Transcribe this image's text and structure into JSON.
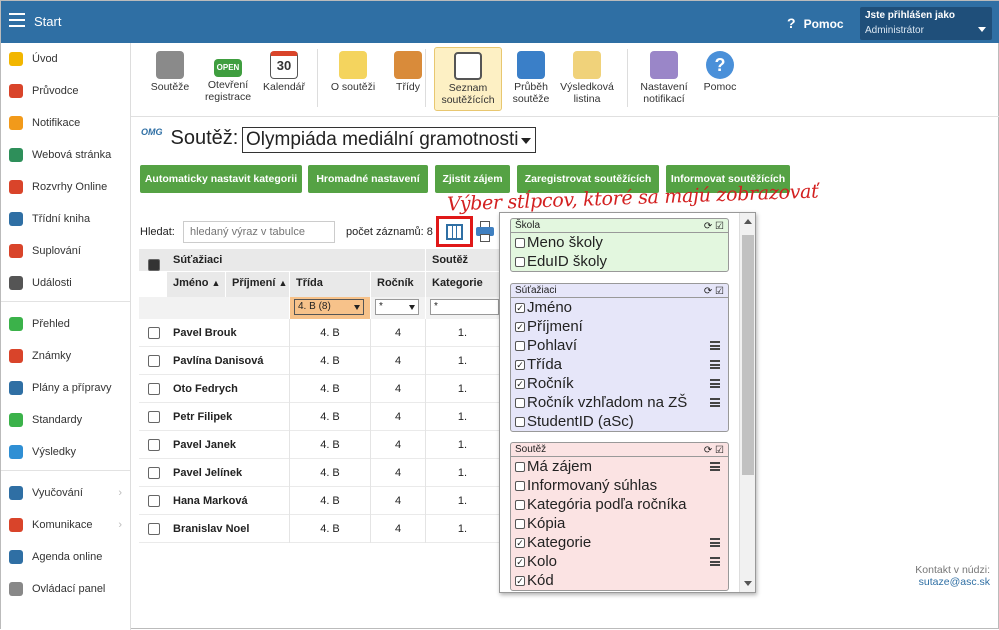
{
  "topbar": {
    "title": "Start",
    "help": "Pomoc",
    "user_line1": "Jste přihlášen jako",
    "user_line2": "Administrátor"
  },
  "sidebar": {
    "items": [
      {
        "label": "Úvod",
        "color": "#f2b600"
      },
      {
        "label": "Průvodce",
        "color": "#d9442a"
      },
      {
        "label": "Notifikace",
        "color": "#f29a1a"
      },
      {
        "label": "Webová stránka",
        "color": "#2e8f5a"
      },
      {
        "label": "Rozvrhy Online",
        "color": "#d9442a"
      },
      {
        "label": "Třídní kniha",
        "color": "#2f6fa4"
      },
      {
        "label": "Suplování",
        "color": "#d9442a"
      },
      {
        "label": "Události",
        "color": "#555555"
      },
      {
        "label": "Přehled",
        "color": "#3bb24a"
      },
      {
        "label": "Známky",
        "color": "#d9442a"
      },
      {
        "label": "Plány a přípravy",
        "color": "#2f6fa4"
      },
      {
        "label": "Standardy",
        "color": "#3bb24a"
      },
      {
        "label": "Výsledky",
        "color": "#2f8fd4"
      },
      {
        "label": "Vyučování",
        "color": "#2f6fa4"
      },
      {
        "label": "Komunikace",
        "color": "#d9442a"
      },
      {
        "label": "Agenda online",
        "color": "#2f6fa4"
      },
      {
        "label": "Ovládací panel",
        "color": "#888888"
      }
    ]
  },
  "toolbar": {
    "items": [
      {
        "label": "Soutěže",
        "icon": "scales-icon"
      },
      {
        "label": "Otevření registrace",
        "icon": "open-sign-icon"
      },
      {
        "label": "Kalendář",
        "icon": "calendar-icon",
        "day": "30",
        "open": "OPEN"
      },
      {
        "label": "O soutěži",
        "icon": "lightbulb-icon"
      },
      {
        "label": "Třídy",
        "icon": "student-icon"
      },
      {
        "label": "Seznam soutěžících",
        "icon": "badge-icon"
      },
      {
        "label": "Průběh soutěže",
        "icon": "stopwatch-icon"
      },
      {
        "label": "Výsledková listina",
        "icon": "certificate-icon"
      },
      {
        "label": "Nastavení notifikací",
        "icon": "gear-icon"
      },
      {
        "label": "Pomoc",
        "icon": "help-icon"
      }
    ]
  },
  "competition": {
    "logo": "OMG",
    "label": "Soutěž:",
    "selected": "Olympiáda mediální gramotnosti"
  },
  "buttons": [
    "Automaticky nastavit kategorii",
    "Hromadné nastavení",
    "Zjistit zájem",
    "Zaregistrovat soutěžících",
    "Informovat soutěžících"
  ],
  "annotation": "Výber stĺpcov, ktoré sa majú zobrazovať",
  "search": {
    "label": "Hledat:",
    "placeholder": "hledaný výraz v tabulce",
    "count_label": "počet záznamů: 8"
  },
  "table": {
    "group1": "Súťažiaci",
    "group2": "Soutěž",
    "headers": {
      "jmeno": "Jméno",
      "prijmeni": "Příjmení",
      "trida": "Třída",
      "rocnik": "Ročník",
      "kategorie": "Kategorie"
    },
    "filters": {
      "trida": "4. B (8)",
      "rocnik": "*",
      "kategorie": "*"
    },
    "rows": [
      {
        "name": "Pavel Brouk",
        "trida": "4. B",
        "rocnik": "4",
        "kat": "1."
      },
      {
        "name": "Pavlína Danisová",
        "trida": "4. B",
        "rocnik": "4",
        "kat": "1."
      },
      {
        "name": "Oto Fedrych",
        "trida": "4. B",
        "rocnik": "4",
        "kat": "1."
      },
      {
        "name": "Petr Filipek",
        "trida": "4. B",
        "rocnik": "4",
        "kat": "1."
      },
      {
        "name": "Pavel Janek",
        "trida": "4. B",
        "rocnik": "4",
        "kat": "1."
      },
      {
        "name": "Pavel Jelínek",
        "trida": "4. B",
        "rocnik": "4",
        "kat": "1."
      },
      {
        "name": "Hana Marková",
        "trida": "4. B",
        "rocnik": "4",
        "kat": "1."
      },
      {
        "name": "Branislav Noel",
        "trida": "4. B",
        "rocnik": "4",
        "kat": "1."
      }
    ]
  },
  "panel": {
    "groups": [
      {
        "title": "Škola",
        "color": "#e3f7df",
        "options": [
          {
            "label": "Meno školy",
            "checked": false,
            "lines": false
          },
          {
            "label": "EduID školy",
            "checked": false,
            "lines": false
          }
        ]
      },
      {
        "title": "Súťažiaci",
        "color": "#e6e6f9",
        "options": [
          {
            "label": "Jméno",
            "checked": true,
            "lines": false
          },
          {
            "label": "Příjmení",
            "checked": true,
            "lines": false
          },
          {
            "label": "Pohlaví",
            "checked": false,
            "lines": true
          },
          {
            "label": "Třída",
            "checked": true,
            "lines": true
          },
          {
            "label": "Ročník",
            "checked": true,
            "lines": true
          },
          {
            "label": "Ročník vzhľadom na ZŠ",
            "checked": false,
            "lines": true
          },
          {
            "label": "StudentID (aSc)",
            "checked": false,
            "lines": false
          }
        ]
      },
      {
        "title": "Soutěž",
        "color": "#fbe3e3",
        "options": [
          {
            "label": "Má zájem",
            "checked": false,
            "lines": true
          },
          {
            "label": "Informovaný súhlas",
            "checked": false,
            "lines": false
          },
          {
            "label": "Kategória podľa ročníka",
            "checked": false,
            "lines": false
          },
          {
            "label": "Kópia",
            "checked": false,
            "lines": false
          },
          {
            "label": "Kategorie",
            "checked": true,
            "lines": true
          },
          {
            "label": "Kolo",
            "checked": true,
            "lines": true
          },
          {
            "label": "Kód",
            "checked": true,
            "lines": false
          }
        ]
      }
    ]
  },
  "contact": {
    "label": "Kontakt v núdzi:",
    "email": "sutaze@asc.sk"
  }
}
